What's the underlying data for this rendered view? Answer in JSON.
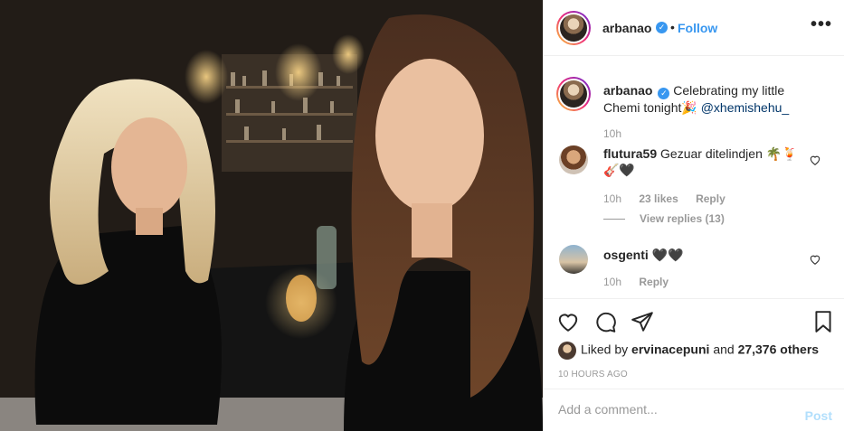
{
  "post": {
    "author": "arbanao",
    "follow_label": "Follow",
    "separator": "•",
    "more_label": "•••",
    "verified_glyph": "✓"
  },
  "caption": {
    "username": "arbanao",
    "text": "Celebrating my little Chemi tonight",
    "emoji": "🎉",
    "mention": "@xhemishehu_",
    "time": "10h"
  },
  "comments": [
    {
      "username": "flutura59",
      "text": "Gezuar ditelindjen 🌴🍹 🎸🖤",
      "time": "10h",
      "likes": "23 likes",
      "reply_label": "Reply",
      "view_replies": "View replies (13)"
    },
    {
      "username": "osgenti",
      "text": "🖤🖤",
      "time": "10h",
      "reply_label": "Reply"
    }
  ],
  "actions": {
    "icons": [
      "heart-icon",
      "comment-icon",
      "share-icon",
      "bookmark-icon"
    ],
    "liked_prefix": "Liked by",
    "liked_user": "ervinacepuni",
    "liked_and": "and",
    "liked_others": "27,376 others",
    "time_ago": "10 HOURS AGO"
  },
  "add_comment": {
    "placeholder": "Add a comment...",
    "post_label": "Post"
  },
  "colors": {
    "link_blue": "#3897f0",
    "mention": "#003569",
    "muted": "#999999",
    "post_disabled": "#b2dffc"
  }
}
